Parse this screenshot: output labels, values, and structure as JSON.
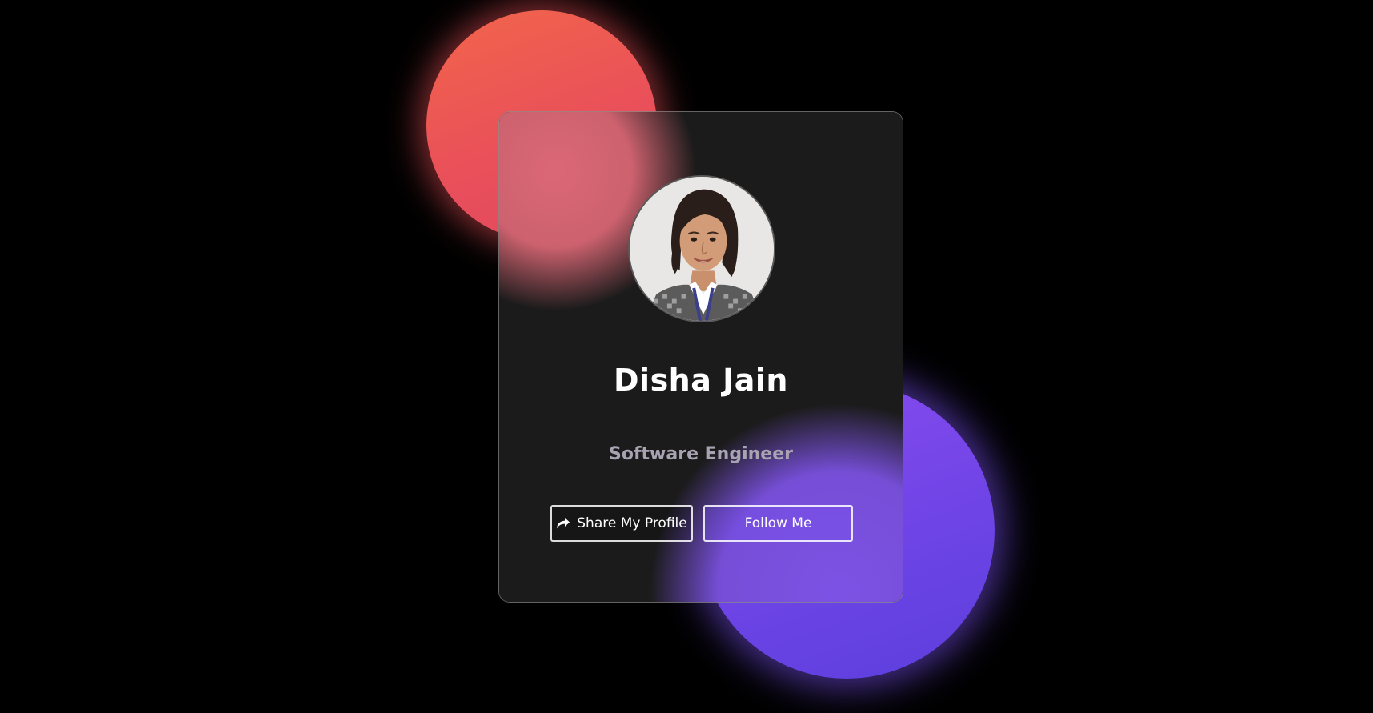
{
  "profile": {
    "name": "Disha Jain",
    "role": "Software Engineer",
    "avatar_alt_icon": "person-photo"
  },
  "actions": {
    "share_label": "Share My Profile",
    "share_icon": "share-arrow-icon",
    "follow_label": "Follow Me"
  },
  "colors": {
    "background": "#000000",
    "orange_blob": "#ea5658",
    "purple_blob": "#6f44e6",
    "card_surface": "#1b1b1b",
    "name_text": "#ffffff",
    "role_text": "#a8a3b0"
  }
}
